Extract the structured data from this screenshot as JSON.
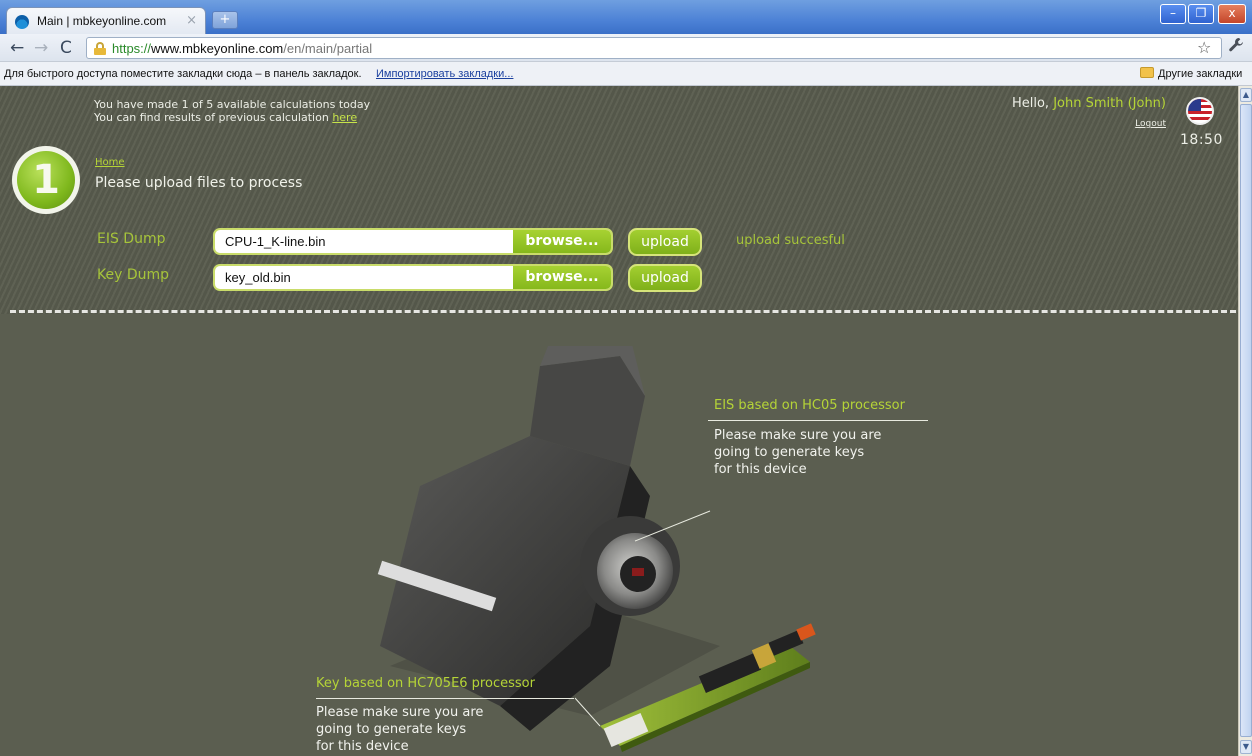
{
  "browser": {
    "tab_title": "Main | mbkeyonline.com",
    "tab_close": "×",
    "new_tab": "+",
    "url_scheme": "https://",
    "url_host": "www.mbkeyonline.com",
    "url_path": "/en/main/partial",
    "bookmarks_hint": "Для быстрого доступа поместите закладки сюда – в панель закладок.",
    "bookmarks_import": "Импортировать закладки...",
    "bookmarks_other": "Другие закладки",
    "window_buttons": {
      "minimize": "–",
      "maximize": "❐",
      "close": "x"
    },
    "nav": {
      "back": "←",
      "forward": "→",
      "reload": "C",
      "star": "☆",
      "wrench": "🔧"
    }
  },
  "header": {
    "calc_line1": "You have made 1 of 5 available calculations today",
    "calc_line2_prefix": "You can find results of previous calculation",
    "calc_line2_link": "here",
    "hello": "Hello,",
    "user_name": "John Smith (John)",
    "logout": "Logout",
    "clock": "18:50",
    "flag_icon": "us-flag-icon"
  },
  "step": {
    "number": "1",
    "breadcrumb": "Home",
    "title": "Please upload files to process"
  },
  "uploads": {
    "eis": {
      "label": "EIS Dump",
      "file": "CPU-1_K-line.bin",
      "browse": "browse...",
      "upload": "upload",
      "status": "upload succesful"
    },
    "key": {
      "label": "Key Dump",
      "file": "key_old.bin",
      "browse": "browse...",
      "upload": "upload"
    }
  },
  "illustration": {
    "eis_title": "EIS based on HC05 processor",
    "eis_text": "Please make sure you are\ngoing to generate keys\nfor this device",
    "key_title": "Key based on HC705E6 processor",
    "key_text": "Please make sure you are\ngoing to generate keys\nfor this device"
  },
  "colors": {
    "accent_green": "#b5d437",
    "page_bg": "#5b5e50",
    "button_green": "#86b81c"
  }
}
